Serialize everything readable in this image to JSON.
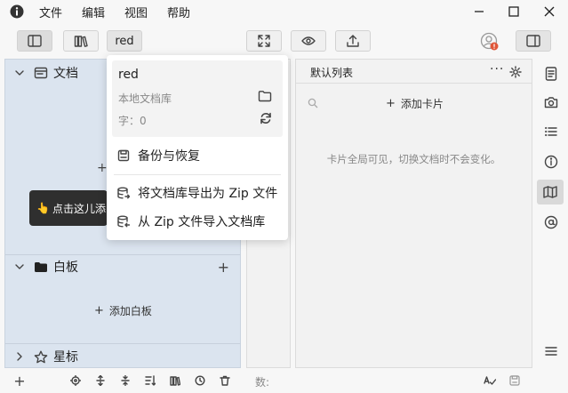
{
  "menu": {
    "file": "文件",
    "edit": "编辑",
    "view": "视图",
    "help": "帮助"
  },
  "toolbar": {
    "repo_button": "red"
  },
  "sections": {
    "docs": {
      "title": "文档"
    },
    "whiteboard": {
      "title": "白板",
      "add_label": "添加白板"
    },
    "stars": {
      "title": "星标"
    }
  },
  "tooltip": {
    "text": "点击这儿添"
  },
  "card_panel": {
    "list_title": "默认列表",
    "add_card": "添加卡片",
    "hint": "卡片全局可见，切换文档时不会变化。"
  },
  "popup": {
    "repo_name": "red",
    "repo_type": "本地文档库",
    "word_count": "字：0",
    "backup": "备份与恢复",
    "export_zip": "将文档库导出为 Zip 文件",
    "import_zip": "从 Zip 文件导入文档库"
  },
  "status": {
    "count_label": "数:"
  },
  "icons": {
    "app": "app-logo-icon",
    "minimize": "minimize-icon",
    "maximize": "maximize-icon",
    "close": "close-icon"
  },
  "colors": {
    "sidebar_bg": "#dbe4ef",
    "tooltip_bg": "#2f2f2f",
    "badge": "#e0573a"
  }
}
